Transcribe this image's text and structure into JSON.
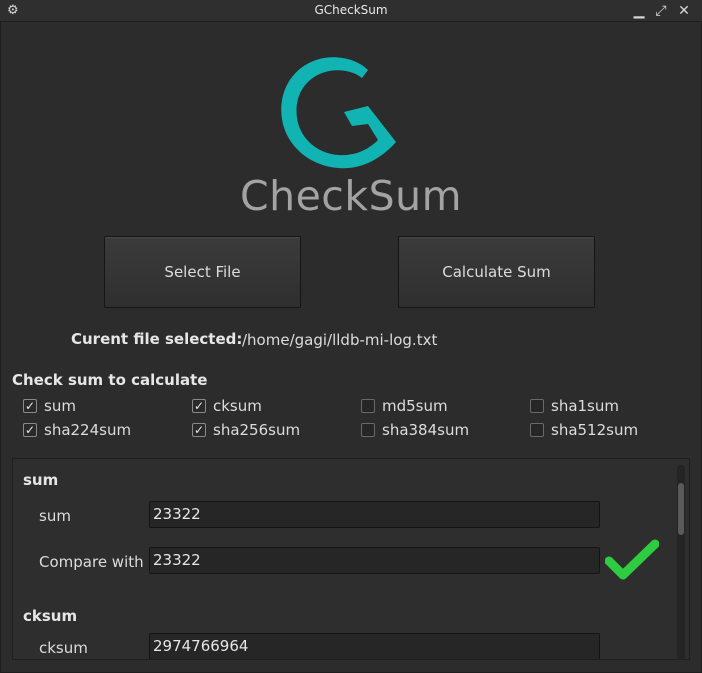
{
  "window": {
    "title": "GCheckSum"
  },
  "logo": {
    "text": "CheckSum",
    "letter": "G",
    "color": "#12b3b3"
  },
  "actions": {
    "select_file": "Select File",
    "calculate_sum": "Calculate Sum"
  },
  "file": {
    "label": "Curent file selected:",
    "path": "/home/gagi/lldb-mi-log.txt"
  },
  "checksums": {
    "title": "Check sum to calculate",
    "options": [
      {
        "label": "sum",
        "checked": true
      },
      {
        "label": "cksum",
        "checked": true
      },
      {
        "label": "md5sum",
        "checked": false
      },
      {
        "label": "sha1sum",
        "checked": false
      },
      {
        "label": "sha224sum",
        "checked": true
      },
      {
        "label": "sha256sum",
        "checked": true
      },
      {
        "label": "sha384sum",
        "checked": false
      },
      {
        "label": "sha512sum",
        "checked": false
      }
    ]
  },
  "results": {
    "sum": {
      "title": "sum",
      "label": "sum",
      "value": "23322",
      "compare_label": "Compare with",
      "compare_value": "23322",
      "match": true
    },
    "cksum": {
      "title": "cksum",
      "label": "cksum",
      "value": "2974766964"
    }
  },
  "colors": {
    "accent": "#12b3b3",
    "success": "#2ecc40"
  }
}
